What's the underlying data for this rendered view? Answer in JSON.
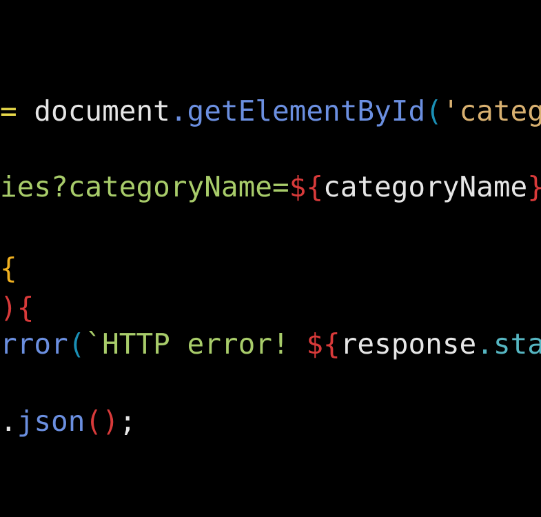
{
  "colors": {
    "background": "#000000",
    "plain": "#e6e6e6",
    "operator": "#e8d94a",
    "method": "#6b8fe0",
    "paren": "#1a8fb5",
    "string": "#d8b070",
    "template_string": "#a8cc6a",
    "interp": "#d83a3a",
    "brace": "#f0b020",
    "brace_alt": "#d83a3a",
    "property": "#56b6c2"
  },
  "code_lines": [
    {
      "tokens": [
        {
          "text": "= ",
          "kind": "operator"
        },
        {
          "text": "document",
          "kind": "plain"
        },
        {
          "text": ".",
          "kind": "method"
        },
        {
          "text": "getElementById",
          "kind": "method"
        },
        {
          "text": "(",
          "kind": "paren"
        },
        {
          "text": "'categ",
          "kind": "string"
        }
      ]
    },
    {
      "tokens": [
        {
          "text": "ies?categoryName=",
          "kind": "template_string"
        },
        {
          "text": "${",
          "kind": "interp"
        },
        {
          "text": "categoryName",
          "kind": "plain"
        },
        {
          "text": "}",
          "kind": "interp"
        }
      ]
    },
    {
      "tokens": [
        {
          "text": "{",
          "kind": "brace"
        }
      ]
    },
    {
      "tokens": [
        {
          "text": ")",
          "kind": "brace_alt"
        },
        {
          "text": "{",
          "kind": "brace_alt"
        }
      ]
    },
    {
      "tokens": [
        {
          "text": "rror",
          "kind": "method"
        },
        {
          "text": "(",
          "kind": "paren"
        },
        {
          "text": "`HTTP error! ",
          "kind": "template_string"
        },
        {
          "text": "${",
          "kind": "interp"
        },
        {
          "text": "response",
          "kind": "plain"
        },
        {
          "text": ".sta",
          "kind": "property"
        }
      ]
    },
    {
      "tokens": [
        {
          "text": ".",
          "kind": "plain"
        },
        {
          "text": "json",
          "kind": "method"
        },
        {
          "text": "()",
          "kind": "brace_alt"
        },
        {
          "text": ";",
          "kind": "plain"
        }
      ]
    }
  ]
}
